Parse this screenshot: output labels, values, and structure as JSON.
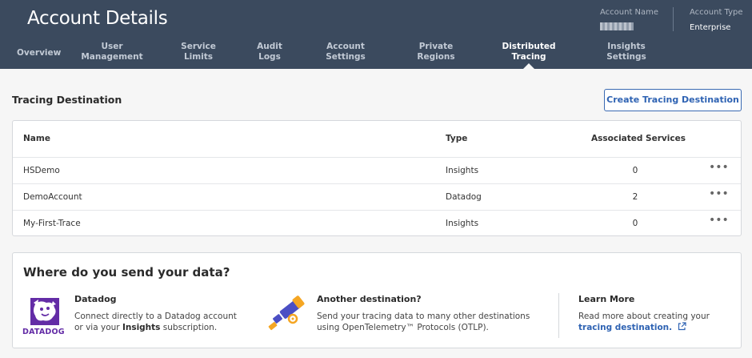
{
  "header": {
    "title": "Account Details",
    "account_name_label": "Account Name",
    "account_type_label": "Account Type",
    "account_type_value": "Enterprise"
  },
  "tabs": [
    {
      "line1": "Overview",
      "line2": ""
    },
    {
      "line1": "User",
      "line2": "Management"
    },
    {
      "line1": "Service",
      "line2": "Limits"
    },
    {
      "line1": "Audit",
      "line2": "Logs"
    },
    {
      "line1": "Account",
      "line2": "Settings"
    },
    {
      "line1": "Private",
      "line2": "Regions"
    },
    {
      "line1": "Distributed",
      "line2": "Tracing"
    },
    {
      "line1": "Insights",
      "line2": "Settings"
    }
  ],
  "active_tab": "Distributed Tracing",
  "section": {
    "title": "Tracing Destination",
    "create_button": "Create Tracing Destination"
  },
  "table": {
    "headers": {
      "name": "Name",
      "type": "Type",
      "services": "Associated Services"
    },
    "rows": [
      {
        "name": "HSDemo",
        "type": "Insights",
        "services": "0",
        "menu": "•••"
      },
      {
        "name": "DemoAccount",
        "type": "Datadog",
        "services": "2",
        "menu": "•••"
      },
      {
        "name": "My-First-Trace",
        "type": "Insights",
        "services": "0",
        "menu": "•••"
      }
    ]
  },
  "info": {
    "title": "Where do you send your data?",
    "datadog": {
      "heading": "Datadog",
      "logo_text": "DATADOG",
      "line1": "Connect directly to a Datadog account",
      "line2_prefix": "or via your ",
      "line2_bold": "Insights",
      "line2_suffix": " subscription."
    },
    "other": {
      "heading": "Another destination?",
      "line1": "Send your tracing data to many other destinations",
      "line2": "using OpenTelemetry™ Protocols (OTLP)."
    },
    "learn": {
      "heading": "Learn More",
      "line1": "Read more about creating your",
      "link": "tracing destination."
    }
  },
  "colors": {
    "header_bg": "#3b4a5e",
    "accent": "#2f63b3",
    "datadog_purple": "#632ca6",
    "telescope_orange": "#f5a623",
    "telescope_indigo": "#4b4fc4"
  },
  "icons": [
    "datadog-logo",
    "telescope-icon",
    "external-link-icon",
    "more-options-icon"
  ]
}
